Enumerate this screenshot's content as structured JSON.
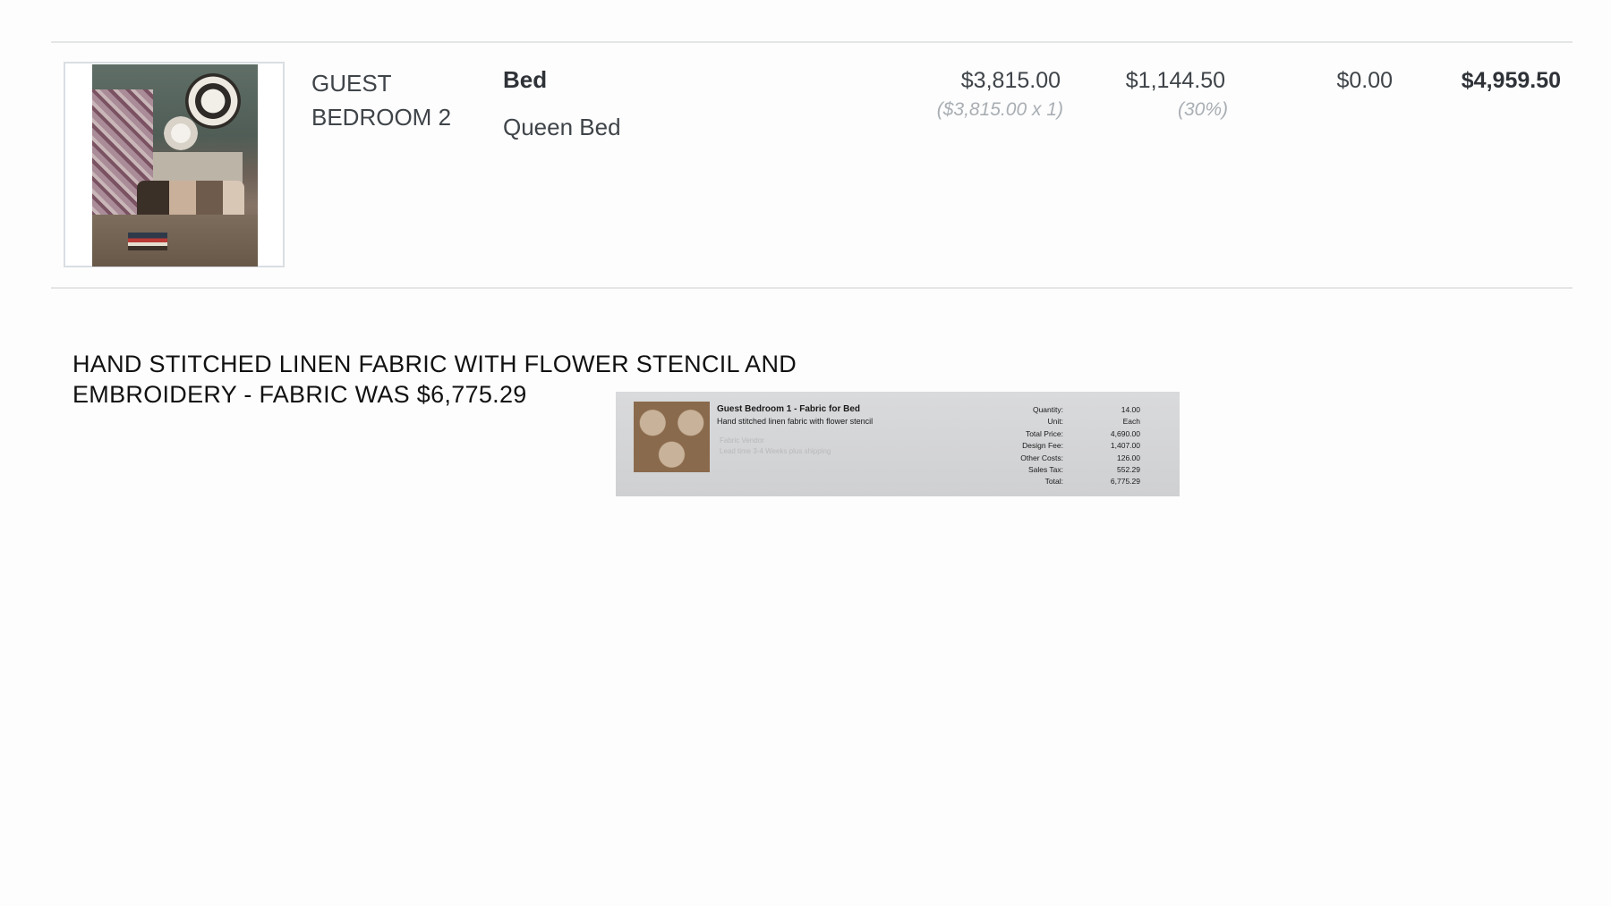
{
  "line_item": {
    "room": [
      "GUEST",
      "BEDROOM 2"
    ],
    "title": "Bed",
    "description": "Queen Bed",
    "unit_price": "$3,815.00",
    "unit_price_detail": "($3,815.00 x 1)",
    "markup": "$1,144.50",
    "markup_detail": "(30%)",
    "tax": "$0.00",
    "total": "$4,959.50"
  },
  "note": {
    "line1": "HAND STITCHED LINEN FABRIC WITH FLOWER STENCIL AND",
    "line2": "EMBROIDERY - FABRIC WAS $6,775.29"
  },
  "receipt": {
    "title": "Guest Bedroom 1 - Fabric for Bed",
    "description": "Hand stitched linen fabric with flower stencil",
    "faint_line1": "Fabric Vendor",
    "faint_line2": "Lead time 3-4 Weeks plus shipping",
    "rows": [
      {
        "label": "Quantity:",
        "value": "14.00"
      },
      {
        "label": "Unit:",
        "value": "Each"
      },
      {
        "label": "Total Price:",
        "value": "4,690.00"
      },
      {
        "label": "Design Fee:",
        "value": "1,407.00"
      },
      {
        "label": "Other Costs:",
        "value": "126.00"
      },
      {
        "label": "Sales Tax:",
        "value": "552.29"
      },
      {
        "label": "Total:",
        "value": "6,775.29"
      }
    ]
  }
}
